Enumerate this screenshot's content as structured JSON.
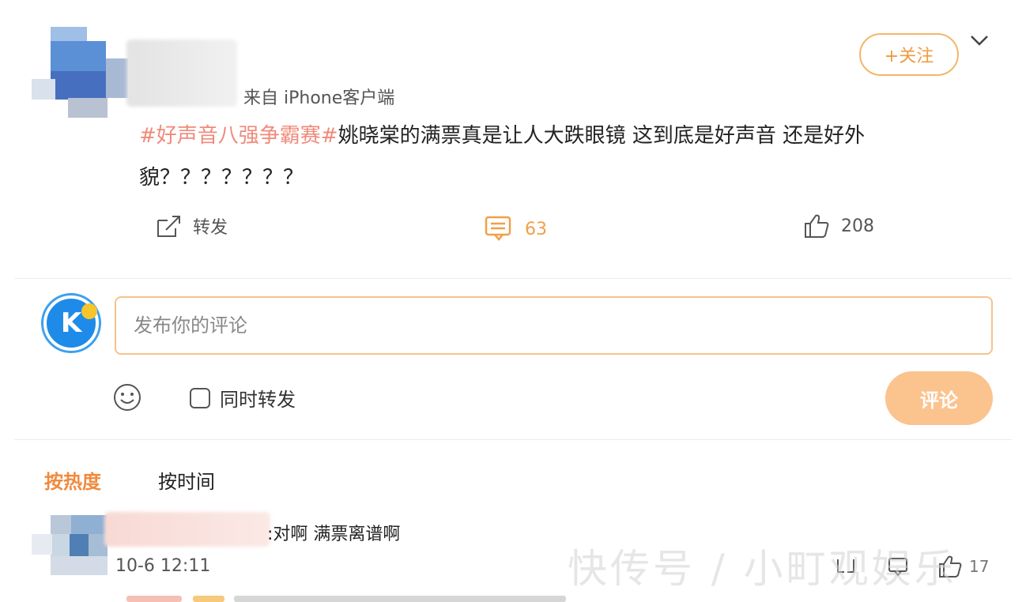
{
  "post": {
    "source": "来自 iPhone客户端",
    "follow_label": "+关注",
    "hashtag": "#好声音八强争霸赛#",
    "body": "姚晓棠的满票真是让人大跌眼镜 这到底是好声音 还是好外貌？？？？？？？",
    "actions": {
      "repost_label": "转发",
      "comment_count": "63",
      "like_count": "208"
    }
  },
  "composer": {
    "placeholder": "发布你的评论",
    "sync_label": "同时转发",
    "submit_label": "评论"
  },
  "sort": {
    "hot_label": "按热度",
    "time_label": "按时间"
  },
  "comments": [
    {
      "text": ":对啊 满票离谱啊",
      "time": "10-6 12:11",
      "like_count": "17"
    }
  ],
  "watermark": "快传号 / 小町观娱乐",
  "colors": {
    "accent": "#f0a048",
    "hashtag": "#f08a7a",
    "submit_bg": "#fbc38e",
    "input_border": "#f5c38b"
  },
  "icons": [
    "chevron-down-icon",
    "repost-icon",
    "comment-icon",
    "like-icon",
    "k-logo-icon",
    "emoji-icon",
    "reply-icon",
    "share-icon",
    "thumb-icon"
  ]
}
